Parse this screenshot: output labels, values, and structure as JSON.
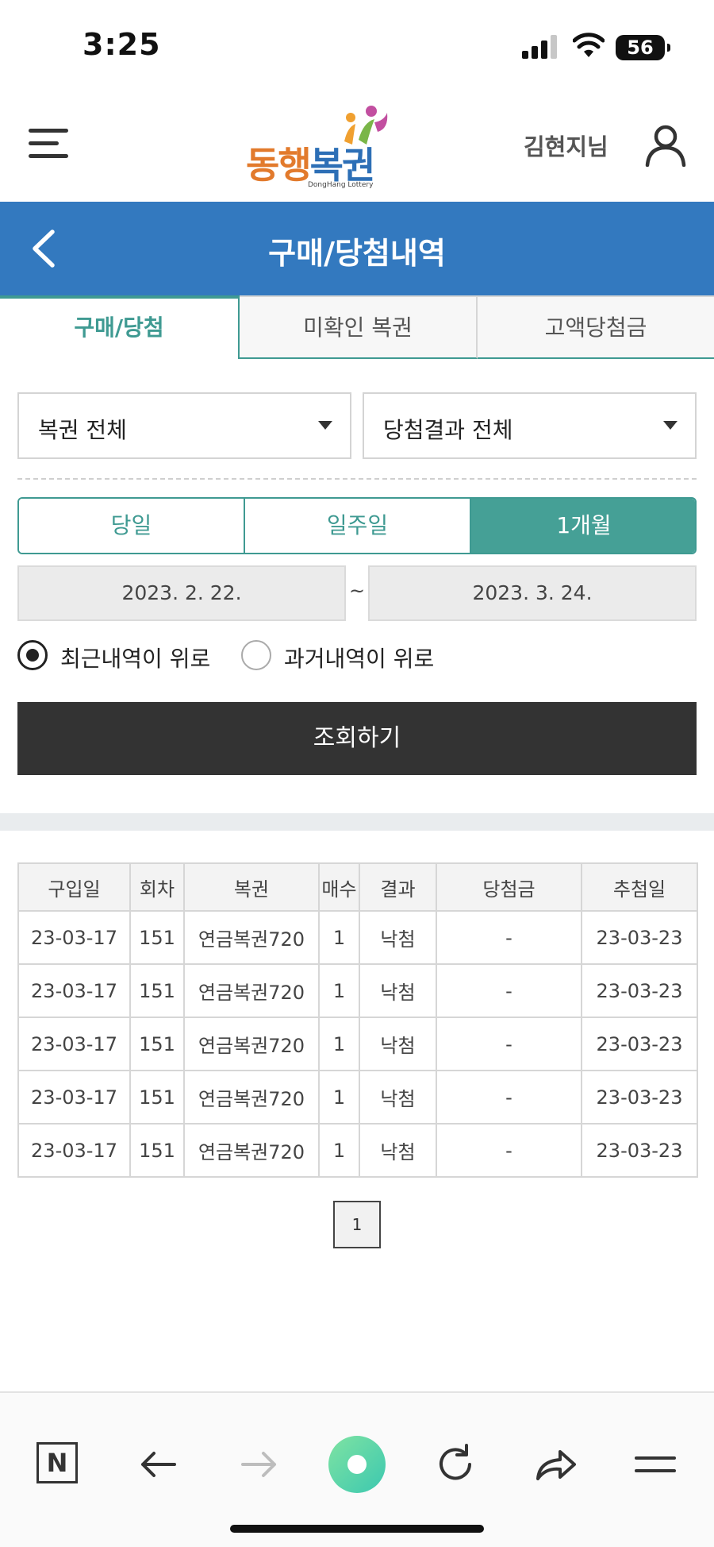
{
  "status_bar": {
    "time": "3:25",
    "battery": "56"
  },
  "header": {
    "logo_main_1": "동행",
    "logo_main_2": "복권",
    "logo_sub": "DongHang Lottery",
    "user_name": "김현지님"
  },
  "title_bar": {
    "title": "구매/당첨내역"
  },
  "tabs": [
    {
      "label": "구매/당첨",
      "active": true
    },
    {
      "label": "미확인 복권",
      "active": false
    },
    {
      "label": "고액당첨금",
      "active": false
    }
  ],
  "filters": {
    "lottery_select": "복권 전체",
    "result_select": "당첨결과 전체"
  },
  "period": {
    "options": [
      "당일",
      "일주일",
      "1개월"
    ],
    "selected": "1개월"
  },
  "dates": {
    "start": "2023. 2. 22.",
    "separator": "~",
    "end": "2023. 3. 24."
  },
  "sort": {
    "options": [
      "최근내역이 위로",
      "과거내역이 위로"
    ],
    "selected": "최근내역이 위로"
  },
  "search_button": "조회하기",
  "table": {
    "headers": [
      "구입일",
      "회차",
      "복권",
      "매수",
      "결과",
      "당첨금",
      "추첨일"
    ],
    "rows": [
      [
        "23-03-17",
        "151",
        "연금복권720",
        "1",
        "낙첨",
        "-",
        "23-03-23"
      ],
      [
        "23-03-17",
        "151",
        "연금복권720",
        "1",
        "낙첨",
        "-",
        "23-03-23"
      ],
      [
        "23-03-17",
        "151",
        "연금복권720",
        "1",
        "낙첨",
        "-",
        "23-03-23"
      ],
      [
        "23-03-17",
        "151",
        "연금복권720",
        "1",
        "낙첨",
        "-",
        "23-03-23"
      ],
      [
        "23-03-17",
        "151",
        "연금복권720",
        "1",
        "낙첨",
        "-",
        "23-03-23"
      ]
    ]
  },
  "pagination": {
    "current": "1"
  },
  "bottom_bar": {
    "home_label": "N"
  },
  "colors": {
    "primary_blue": "#3379bf",
    "teal": "#3f9a92",
    "button_dark": "#333333"
  }
}
